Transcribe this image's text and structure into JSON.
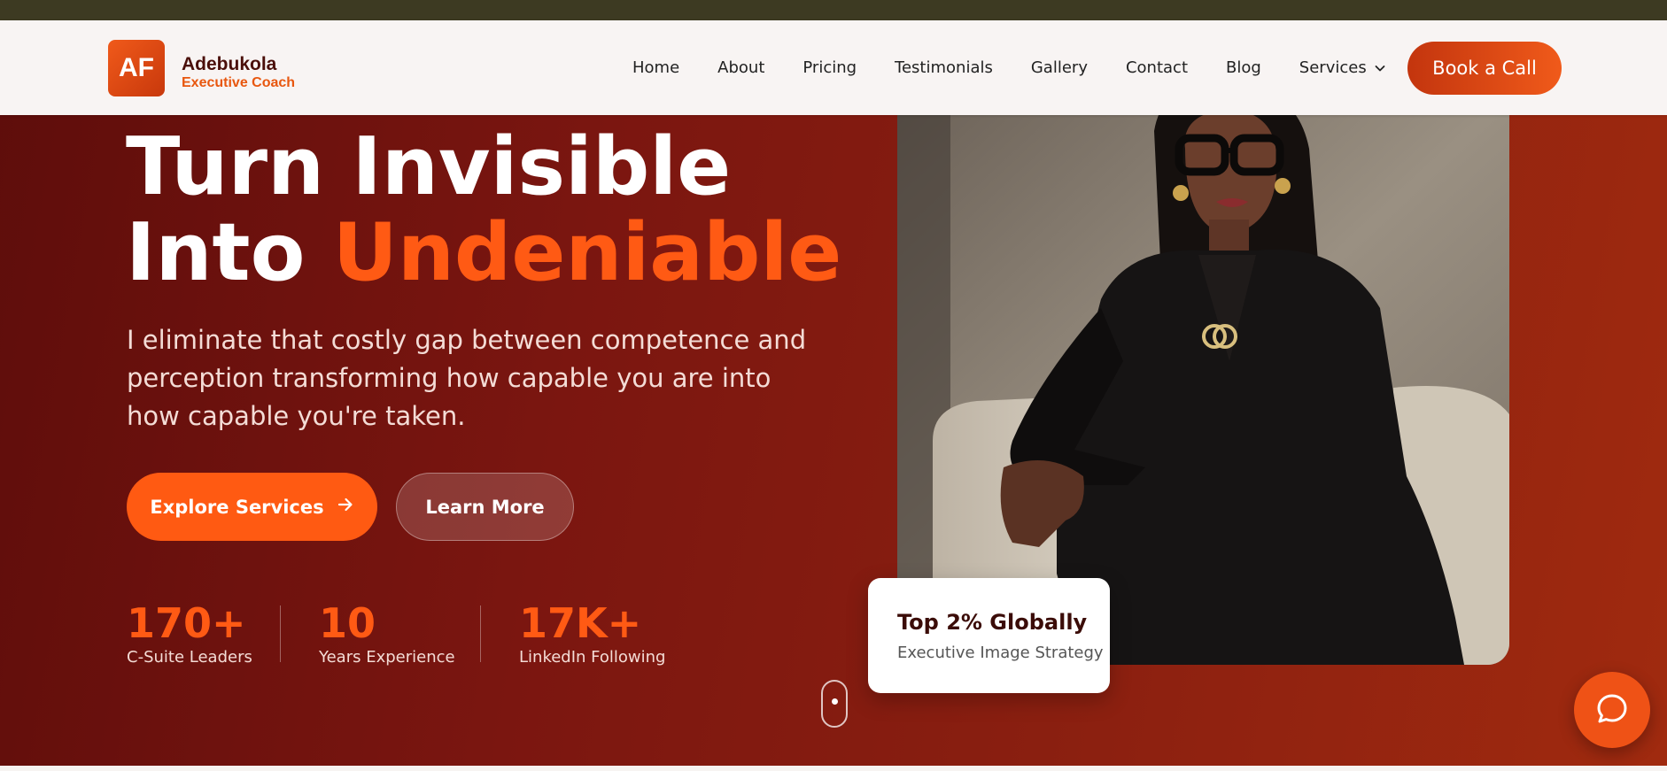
{
  "header": {
    "logo_initials": "AF",
    "brand_name": "Adebukola",
    "brand_tagline": "Executive Coach",
    "nav": [
      {
        "label": "Home"
      },
      {
        "label": "About"
      },
      {
        "label": "Pricing"
      },
      {
        "label": "Testimonials"
      },
      {
        "label": "Gallery"
      },
      {
        "label": "Contact"
      },
      {
        "label": "Blog"
      },
      {
        "label": "Services",
        "icon": "chevron-down-icon"
      }
    ],
    "cta_label": "Book a Call"
  },
  "hero": {
    "headline_line1": "Turn Invisible",
    "headline_line2_prefix": "Into ",
    "headline_line2_accent": "Undeniable",
    "subtext": "I eliminate that costly gap between competence and perception transforming how capable you are into how capable you're taken.",
    "primary_button": {
      "label": "Explore Services",
      "icon": "arrow-right-icon"
    },
    "secondary_button": {
      "label": "Learn More"
    },
    "stats": [
      {
        "value": "170+",
        "label": "C-Suite Leaders"
      },
      {
        "value": "10",
        "label": "Years Experience"
      },
      {
        "value": "17K+",
        "label": "LinkedIn Following"
      }
    ]
  },
  "badge_card": {
    "title": "Top 2% Globally",
    "subtitle": "Executive Image Strategy"
  },
  "chat_widget": {
    "icon": "chat-bubble-icon"
  },
  "colors": {
    "accent": "#ff5a14",
    "hero_dark": "#5e0d0b",
    "hero_light": "#a02a0f",
    "navbar_bg": "#f8f4f3",
    "brand_text": "#4a0f0a"
  }
}
